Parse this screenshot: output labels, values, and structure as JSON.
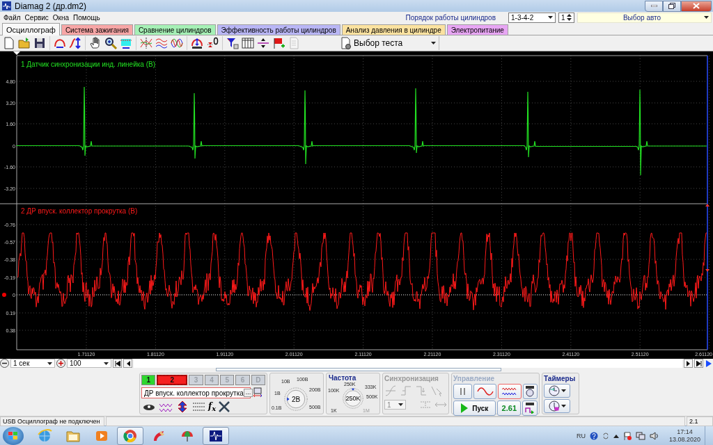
{
  "window": {
    "title": "Diamag 2 (др.dm2)"
  },
  "menu": [
    "Файл",
    "Сервис",
    "Окна",
    "Помощь"
  ],
  "cylinder_order": {
    "label": "Порядок работы цилиндров",
    "value": "1-3-4-2",
    "cylinder": "1"
  },
  "car_select": "Выбор авто",
  "tabs": [
    {
      "label": "Осциллограф",
      "selected": true,
      "color": "#f9f9f9"
    },
    {
      "label": "Система зажигания",
      "selected": false,
      "color": "#f7a6a6"
    },
    {
      "label": "Сравнение цилиндров",
      "selected": false,
      "color": "#a6f0b6"
    },
    {
      "label": "Эффективность работы цилиндров",
      "selected": false,
      "color": "#b9b6f5"
    },
    {
      "label": "Анализ давления в цилиндре",
      "selected": false,
      "color": "#fbe2a0"
    },
    {
      "label": "Электропитание",
      "selected": false,
      "color": "#e7a6f3"
    }
  ],
  "toolbar": {
    "test_select": "Выбор теста"
  },
  "scope": {
    "channels": [
      {
        "title": "1 Датчик синхронизации инд. линейка (В)",
        "color": "#22e022",
        "yticks": [
          "4.80",
          "3.20",
          "1.60",
          "0",
          "-1.60",
          "-3.20"
        ]
      },
      {
        "title": "2 ДР впуск. коллектор прокрутка (В)",
        "color": "#ff1a1a",
        "yticks": [
          "-0.76",
          "-0.57",
          "-0.38",
          "-0.19",
          "0",
          "0.19",
          "0.38"
        ]
      }
    ],
    "xticks": [
      "1.71120",
      "1.81120",
      "1.91120",
      "2.01120",
      "2.11120",
      "2.21120",
      "2.31120",
      "2.41120",
      "2.51120",
      "2.61120"
    ]
  },
  "timebase": {
    "time": "1 сек",
    "scale": "100"
  },
  "control_panel": {
    "channels": [
      {
        "label": "1",
        "selected": false,
        "disabled": false,
        "color": "#2ed62e"
      },
      {
        "label": "2",
        "selected": true,
        "disabled": false,
        "color": "#f52020"
      },
      {
        "label": "3",
        "selected": false,
        "disabled": true,
        "color": "#cdd2da"
      },
      {
        "label": "4",
        "selected": false,
        "disabled": true,
        "color": "#cdd2da"
      },
      {
        "label": "5",
        "selected": false,
        "disabled": true,
        "color": "#cdd2da"
      },
      {
        "label": "6",
        "selected": false,
        "disabled": true,
        "color": "#cdd2da"
      },
      {
        "label": "D",
        "selected": false,
        "disabled": true,
        "color": "#cdd2da"
      }
    ],
    "channel_name": "ДР впуск. коллектор прокрутка",
    "more_button": "...",
    "formula_button": "f$_{x}$",
    "voltage": {
      "labels": [
        "10В",
        "100В",
        "200В",
        "500В",
        "0.1В",
        "1В"
      ],
      "value": "2В"
    },
    "frequency": {
      "title": "Частота",
      "value": "250K",
      "labels": [
        {
          "text": "250K",
          "disabled": false
        },
        {
          "text": "100K",
          "disabled": false
        },
        {
          "text": "333K",
          "disabled": false
        },
        {
          "text": "500K",
          "disabled": false
        },
        {
          "text": "1K",
          "disabled": false
        },
        {
          "text": "1M",
          "disabled": true
        }
      ]
    },
    "sync": {
      "title": "Синхронизация",
      "disabled": true,
      "channel": "1"
    },
    "control": {
      "title": "Управление",
      "start": "Пуск",
      "value": "2.61"
    },
    "timers": {
      "title": "Таймеры"
    }
  },
  "status_bar": {
    "message": "USB Осциллограф не подключен",
    "version": "2.1"
  },
  "taskbar": {
    "apps": [
      {
        "kind": "globe",
        "active": false
      },
      {
        "kind": "folder",
        "active": false
      },
      {
        "kind": "player",
        "active": false
      },
      {
        "kind": "browser",
        "active": true
      },
      {
        "kind": "brush",
        "active": false
      },
      {
        "kind": "umbrella",
        "active": false
      },
      {
        "kind": "scope",
        "active": true
      }
    ],
    "language": "RU",
    "time": "17:14",
    "date": "13.08.2020"
  }
}
